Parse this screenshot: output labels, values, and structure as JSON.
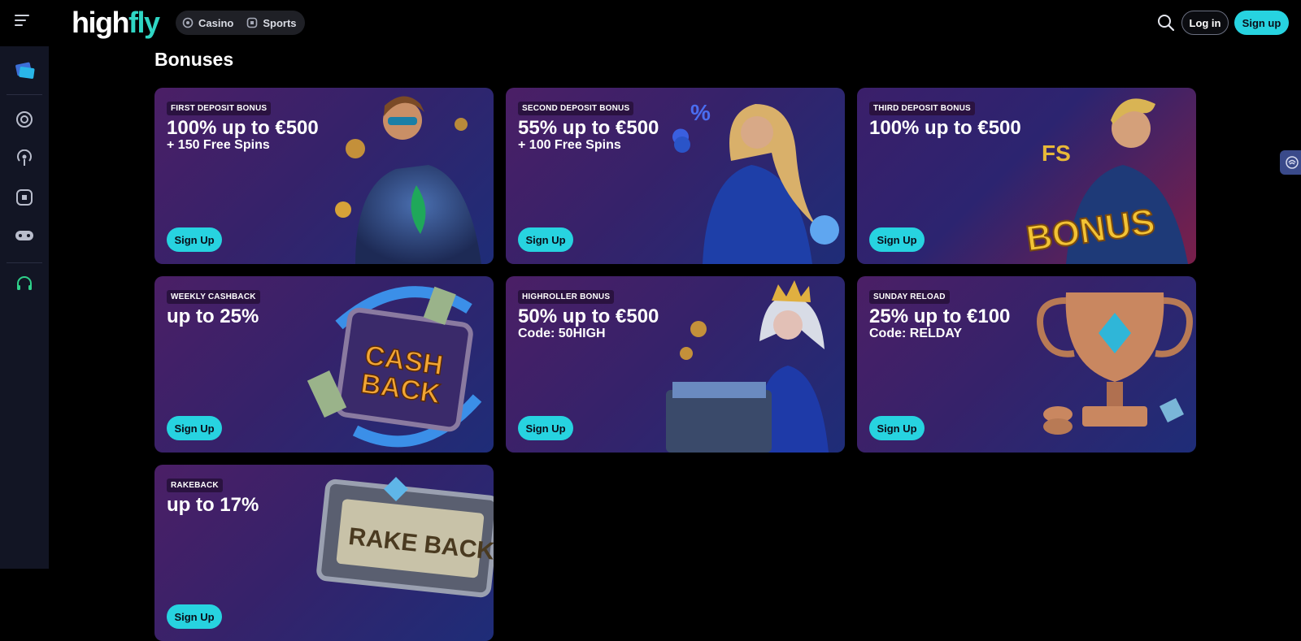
{
  "header": {
    "logo_part1": "high",
    "logo_part2": "fly",
    "nav": [
      {
        "label": "Casino",
        "icon": "casino-chip-icon"
      },
      {
        "label": "Sports",
        "icon": "sports-ball-icon"
      }
    ],
    "login_label": "Log in",
    "signup_label": "Sign up"
  },
  "sidebar": {
    "items": [
      {
        "name": "promo-cards-icon"
      },
      {
        "name": "casino-chip-icon"
      },
      {
        "name": "live-broadcast-icon"
      },
      {
        "name": "sports-ball-icon"
      },
      {
        "name": "gamepad-icon"
      },
      {
        "name": "support-headset-icon"
      }
    ]
  },
  "main": {
    "title": "Bonuses",
    "cards": [
      {
        "badge": "FIRST DEPOSIT BONUS",
        "headline": "100% up to €500",
        "subline": "+ 150 Free Spins",
        "cta": "Sign Up"
      },
      {
        "badge": "SECOND DEPOSIT BONUS",
        "headline": "55% up to €500",
        "subline": "+ 100 Free Spins",
        "cta": "Sign Up"
      },
      {
        "badge": "THIRD DEPOSIT BONUS",
        "headline": "100% up to €500",
        "subline": "",
        "cta": "Sign Up"
      },
      {
        "badge": "WEEKLY CASHBACK",
        "headline": "up to 25%",
        "subline": "",
        "cta": "Sign Up"
      },
      {
        "badge": "HIGHROLLER BONUS",
        "headline": "50% up to €500",
        "subline": "Code: 50HIGH",
        "cta": "Sign Up"
      },
      {
        "badge": "SUNDAY RELOAD",
        "headline": "25% up to €100",
        "subline": "Code: RELDAY",
        "cta": "Sign Up"
      },
      {
        "badge": "RAKEBACK",
        "headline": "up to 17%",
        "subline": "",
        "cta": "Sign Up"
      }
    ],
    "art_text": {
      "bonus": "BONUS",
      "cash": "CASH",
      "back": "BACK",
      "rakeback": "RAKE BACK",
      "fs": "FS"
    }
  },
  "colors": {
    "accent": "#27d3e0",
    "logo_accent": "#2fd6c4",
    "sidebar_bg": "#121524",
    "card_purple": "#4b1f66",
    "card_blue": "#1e2d78"
  }
}
